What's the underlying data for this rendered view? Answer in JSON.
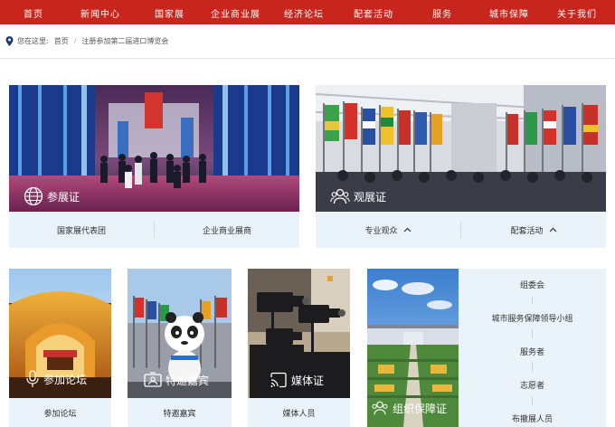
{
  "nav": {
    "items": [
      "首页",
      "新闻中心",
      "国家展",
      "企业商业展",
      "经济论坛",
      "配套活动",
      "服务",
      "城市保障",
      "关于我们"
    ]
  },
  "breadcrumb": {
    "prefix": "您在这里:",
    "home": "首页",
    "separator": "/",
    "current": "注册参加第二届进口博览会"
  },
  "cards": {
    "exhibitor": {
      "title": "参展证",
      "links": [
        "国家展代表团",
        "企业商业展商"
      ]
    },
    "visitor": {
      "title": "观展证",
      "links": [
        "专业观众",
        "配套活动"
      ]
    },
    "forum": {
      "title": "参加论坛",
      "link": "参加论坛"
    },
    "guest": {
      "title": "特邀嘉宾",
      "link": "特邀嘉宾"
    },
    "media": {
      "title": "媒体证",
      "link": "媒体人员"
    },
    "support": {
      "title": "组织保障证",
      "links": [
        "组委会",
        "城市服务保障领导小组",
        "服务者",
        "志愿者",
        "布撤展人员"
      ]
    }
  },
  "colors": {
    "nav_bg": "#c8251c",
    "panel_bg": "#eaf2fa"
  }
}
